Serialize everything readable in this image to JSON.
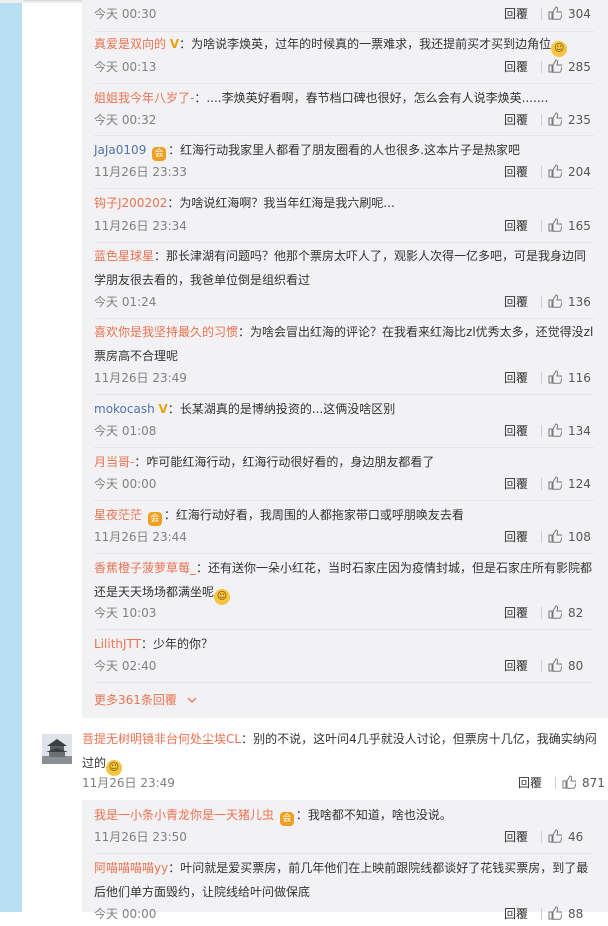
{
  "reply_label": "回覆",
  "more_replies": "更多361条回覆",
  "replies": [
    {
      "time": "今天 00:30",
      "likes": "304"
    },
    {
      "name": "真爱是双向的",
      "text": "：为啥说李焕英，过年的时候真的一票难求，我还提前买才买到边角位",
      "time": "今天 00:13",
      "likes": "285"
    },
    {
      "name": "姐姐我今年八岁了-",
      "text": "：....李焕英好看啊，春节档口碑也很好，怎么会有人说李焕英.......",
      "time": "今天 00:32",
      "likes": "235"
    },
    {
      "name": "JaJa0109",
      "text": "：红海行动我家里人都看了朋友圈看的人也很多.这本片子是热家吧",
      "time": "11月26日 23:33",
      "likes": "204"
    },
    {
      "name": "钩子J200202",
      "text": "：为啥说红海啊？我当年红海是我六刷呢...",
      "time": "11月26日 23:34",
      "likes": "165"
    },
    {
      "name": "蓝色星球星",
      "text": "：那长津湖有问题吗？他那个票房太吓人了，观影人次得一亿多吧，可是我身边同学朋友很去看的，我爸单位倒是组织看过",
      "time": "今天 01:24",
      "likes": "136"
    },
    {
      "name": "喜欢你是我坚持最久的习惯",
      "text": "：为啥会冒出红海的评论？在我看来红海比zl优秀太多，还觉得没zl票房高不合理呢",
      "time": "11月26日 23:49",
      "likes": "116"
    },
    {
      "name": "mokocash",
      "text": "：长某湖真的是博纳投资的...这俩没啥区别",
      "time": "今天 01:08",
      "likes": "134"
    },
    {
      "name": "月当哥-",
      "text": "：咋可能红海行动，红海行动很好看的，身边朋友都看了",
      "time": "今天 00:00",
      "likes": "124"
    },
    {
      "name": "星夜茫茫",
      "text": "：红海行动好看，我周围的人都拖家带口或呼朋唤友去看",
      "time": "11月26日 23:44",
      "likes": "108"
    },
    {
      "name": "香蕉橙子菠萝草莓_",
      "text": "：还有送你一朵小红花，当时石家庄因为疫情封城，但是石家庄所有影院都还是天天场场都满坐呢",
      "time": "今天 10:03",
      "likes": "82"
    },
    {
      "name": "LilithJTT",
      "text": "：少年的你？",
      "time": "今天 02:40",
      "likes": "80"
    }
  ],
  "main_comment": {
    "name": "菩提无树明镜非台何处尘埃CL",
    "text": "：别的不说，这叶问4几乎就没人讨论，但票房十几亿，我确实纳闷过的",
    "time": "11月26日 23:49",
    "likes": "871"
  },
  "sub_replies": [
    {
      "name": "我是一小条小青龙你是一天猪儿虫",
      "text": "：我啥都不知道，啥也没说。",
      "time": "11月26日 23:50",
      "likes": "46"
    },
    {
      "name": "阿喵喵喵喵yy",
      "text": "：叶问就是爱买票房，前几年他们在上映前跟院线都谈好了花钱买票房，到了最后他们单方面毁约，让院线给叶问做保底",
      "time": "今天 00:00",
      "likes": "88"
    }
  ]
}
